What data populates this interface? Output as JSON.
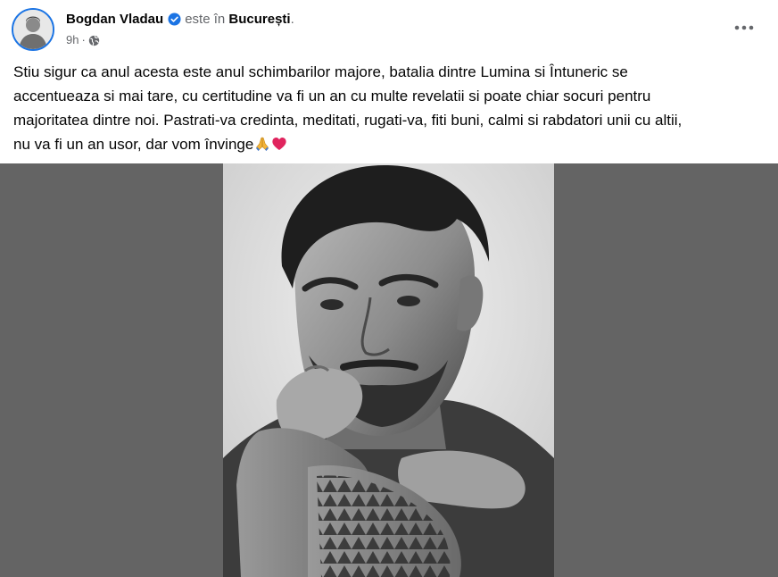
{
  "post": {
    "author": "Bogdan Vladau",
    "location_prefix": "este în",
    "location": "București",
    "location_suffix": ".",
    "time": "9h",
    "dot": "·",
    "text_lines": [
      "Stiu sigur ca anul acesta este anul schimbarilor majore, batalia dintre Lumina si Întuneric se",
      "accentueaza si mai tare, cu certitudine va fi un an cu multe revelatii si poate chiar socuri pentru",
      "majoritatea dintre noi. Pastrati-va credinta, meditati, rugati-va, fiti buni, calmi si rabdatori unii cu altii,",
      "nu va fi un an usor, dar vom învinge"
    ],
    "text_emojis": [
      "praying-hands",
      "red-heart"
    ]
  },
  "icons": {
    "verified": "verified-badge-icon",
    "audience": "globe-icon",
    "more": "more-options-icon"
  },
  "colors": {
    "accent": "#1b74e4",
    "secondary_text": "#65676b",
    "photo_background": "#646464",
    "heart": "#e0245e"
  }
}
